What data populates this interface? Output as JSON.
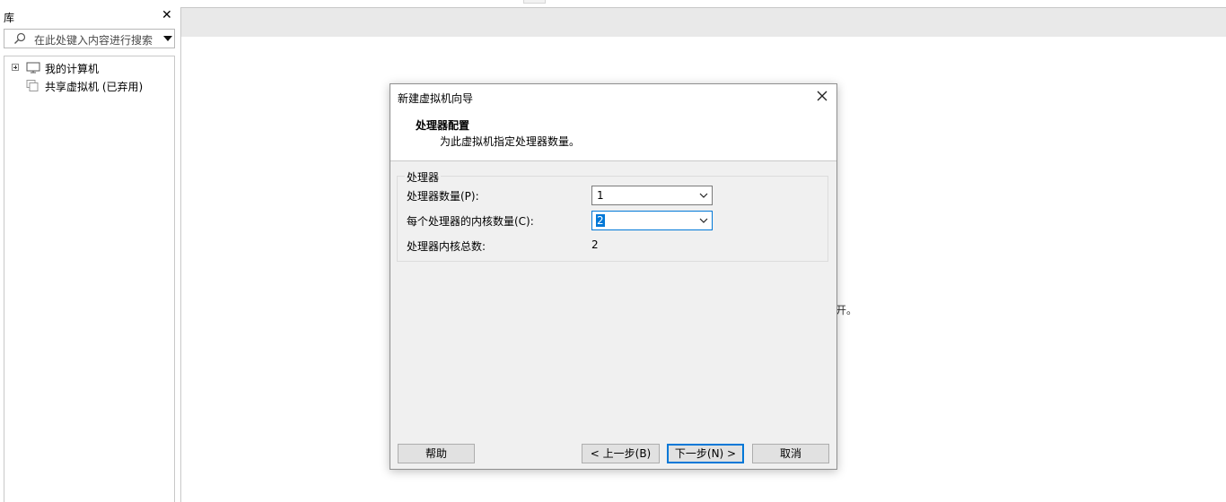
{
  "library": {
    "title": "库",
    "close_glyph": "✕",
    "search": {
      "placeholder": "在此处键入内容进行搜索",
      "icon": "search-icon"
    },
    "tree": [
      {
        "label": "我的计算机",
        "icon": "computer-icon",
        "expandable": true
      },
      {
        "label": "共享虚拟机 (已弃用)",
        "icon": "shared-vm-icon",
        "expandable": false
      }
    ]
  },
  "background": {
    "text_fragment": "开。"
  },
  "wizard": {
    "title": "新建虚拟机向导",
    "heading": "处理器配置",
    "subheading": "为此虚拟机指定处理器数量。",
    "group_label": "处理器",
    "fields": {
      "processor_count": {
        "label": "处理器数量(P):",
        "value": "1"
      },
      "cores_per_processor": {
        "label": "每个处理器的内核数量(C):",
        "value": "2"
      },
      "total_cores": {
        "label": "处理器内核总数:",
        "value": "2"
      }
    },
    "buttons": {
      "help": "帮助",
      "back": "< 上一步(B)",
      "next": "下一步(N) >",
      "cancel": "取消"
    }
  },
  "colors": {
    "accent": "#0078d7",
    "dialog_bg": "#f0f0f0",
    "strip_bg": "#e9e9e9"
  }
}
